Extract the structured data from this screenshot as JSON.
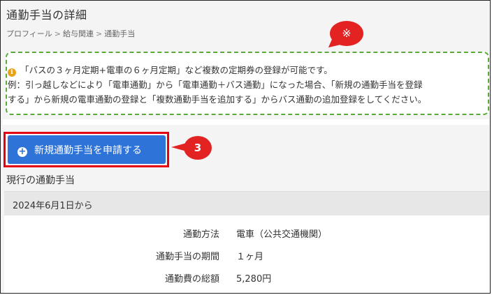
{
  "page": {
    "title": "通勤手当の詳細",
    "breadcrumb": [
      "プロフィール",
      "給与関連",
      "通勤手当"
    ],
    "breadcrumb_separator": ">"
  },
  "notice": {
    "line1": "「バスの３ヶ月定期+電車の６ヶ月定期」など複数の定期券の登録が可能です。",
    "line2": "例：引っ越しなどにより「電車通勤」から「電車通勤＋バス通勤」になった場合、「新規の通勤手当を登録",
    "line3": "する」から新規の電車通勤の登録と「複数通勤手当を追加する」からバス通勤の追加登録をしてください。",
    "icon": "info-circle-icon",
    "border_color": "#5aaa3a"
  },
  "annotations": {
    "note_mark": "※",
    "step_number": "3",
    "color": "#e32222"
  },
  "actions": {
    "apply_button_label": "新規通勤手当を申請する",
    "apply_button_icon": "plus-circle-icon",
    "apply_button_color": "#2d73d8"
  },
  "current": {
    "section_title": "現行の通勤手当",
    "effective_from": "2024年6月1日から",
    "details": [
      {
        "label": "通勤方法",
        "value": "電車（公共交通機関）"
      },
      {
        "label": "通勤手当の期間",
        "value": "１ヶ月"
      },
      {
        "label": "通勤費の総額",
        "value": "5,280円"
      }
    ]
  }
}
